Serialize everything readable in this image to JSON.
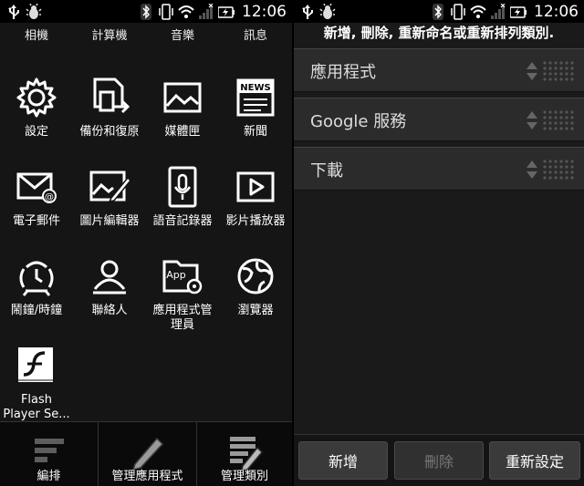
{
  "status_left": {
    "time": "12:06"
  },
  "status_right": {
    "time": "12:06"
  },
  "left": {
    "top_labels": [
      "相機",
      "計算機",
      "音樂",
      "訊息"
    ],
    "apps": [
      {
        "label": "設定",
        "icon": "gear-icon"
      },
      {
        "label": "備份和復原",
        "icon": "backup-icon"
      },
      {
        "label": "媒體匣",
        "icon": "gallery-icon"
      },
      {
        "label": "新聞",
        "icon": "news-icon",
        "icon_text": "NEWS"
      },
      {
        "label": "電子郵件",
        "icon": "email-icon"
      },
      {
        "label": "圖片編輯器",
        "icon": "photo-editor-icon"
      },
      {
        "label": "語音記錄器",
        "icon": "voice-recorder-icon"
      },
      {
        "label": "影片播放器",
        "icon": "video-player-icon"
      },
      {
        "label": "鬧鐘/時鐘",
        "icon": "alarm-clock-icon"
      },
      {
        "label": "聯絡人",
        "icon": "contacts-icon"
      },
      {
        "label": "應用程式管理員",
        "icon": "app-manager-icon",
        "icon_text": "App"
      },
      {
        "label": "瀏覽器",
        "icon": "browser-icon"
      },
      {
        "label": "Flash Player Se...",
        "icon": "flash-icon"
      }
    ],
    "bottom": {
      "arrange": "編排",
      "manage_apps": "管理應用程式",
      "manage_categories": "管理類別"
    }
  },
  "right": {
    "header": "新增, 刪除, 重新命名或重新排列類別.",
    "categories": [
      "應用程式",
      "Google 服務",
      "下載"
    ],
    "buttons": {
      "add": "新增",
      "delete": "刪除",
      "reset": "重新設定"
    }
  }
}
